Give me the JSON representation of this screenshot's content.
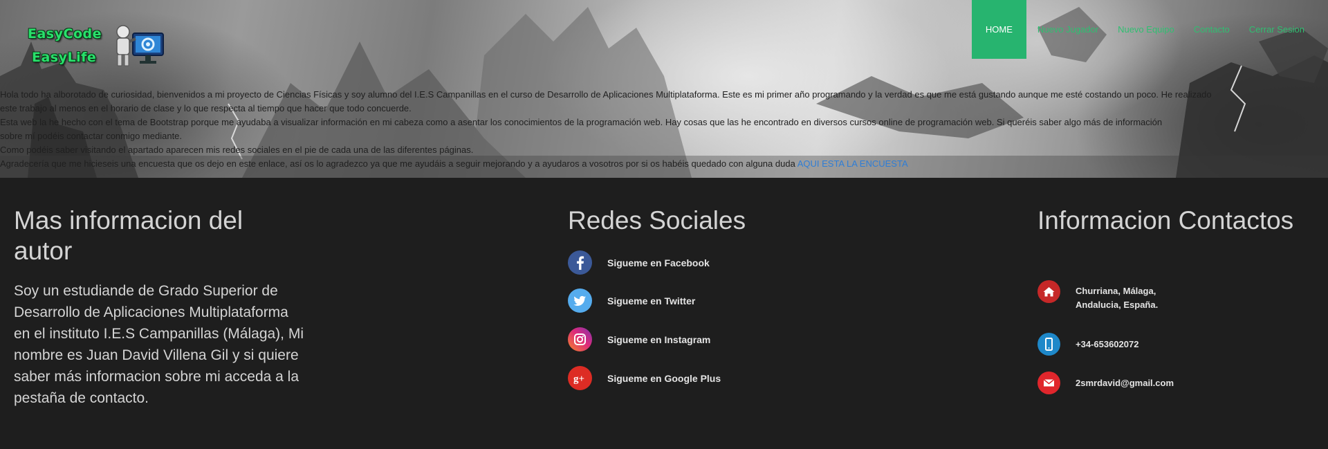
{
  "logo": {
    "line1": "EasyCode",
    "line2": "EasyLife"
  },
  "nav": {
    "items": [
      {
        "label": "HOME",
        "active": true
      },
      {
        "label": "Nuevo Jugador"
      },
      {
        "label": "Nuevo Equipo"
      },
      {
        "label": "Contacto"
      },
      {
        "label": "Cerrar Sesion"
      }
    ]
  },
  "intro": {
    "line1": "Hola todo ha alborotado de curiosidad, bienvenidos a mi proyecto de Ciencias Físicas y soy alumno del I.E.S Campanillas en el curso de Desarrollo de Aplicaciones Multiplataforma. Este es mi primer año programando y la verdad es que me está gustando aunque me esté costando un poco. He realizado",
    "line2": "este trabajo al menos en el horario de clase y lo que respecta al tiempo que hacer que todo concuerde.",
    "line3": "Esta web la he hecho con el tema de Bootstrap porque me ayudaba a visualizar información en mi cabeza como a asentar los conocimientos de la programación web. Hay cosas que las he encontrado en diversos cursos online de programación web. Si queréis saber algo más de información",
    "line4": "sobre mí podéis contactar conmigo mediante.",
    "line5": "Como podéis saber visitando el apartado aparecen mis redes sociales en el pie de cada una de las diferentes páginas.",
    "line6": "Agradecería que me hicieseis una encuesta que os dejo en este enlace, así os lo agradezco ya que me ayudáis a seguir mejorando y a ayudaros a vosotros por si os habéis quedado con alguna duda",
    "link": "AQUI ESTA LA ENCUESTA"
  },
  "about": {
    "title": "Mas informacion del autor",
    "text": "Soy un estudiande de Grado Superior de Desarrollo de Aplicaciones Multiplataforma en el instituto I.E.S Campanillas (Málaga), Mi nombre es Juan David Villena Gil y si quiere saber más informacion sobre mi acceda a la pestaña de contacto."
  },
  "social": {
    "title": "Redes Sociales",
    "items": [
      {
        "label": "Sigueme en Facebook",
        "icon": "facebook-icon",
        "color": "#3b5998"
      },
      {
        "label": "Sigueme en Twitter",
        "icon": "twitter-icon",
        "color": "#55acee"
      },
      {
        "label": "Sigueme en Instagram",
        "icon": "instagram-icon",
        "color": "#c13584"
      },
      {
        "label": "Sigueme en Google Plus",
        "icon": "google-plus-icon",
        "color": "#dd2c24"
      }
    ]
  },
  "contact": {
    "title": "Informacion Contactos",
    "address_line1": "Churriana, Málaga,",
    "address_line2": "Andalucia, España.",
    "phone": "+34-653602072",
    "email": "2smrdavid@gmail.com",
    "colors": {
      "home": "#c62828",
      "phone": "#1e88c9",
      "email": "#e0262c"
    }
  }
}
